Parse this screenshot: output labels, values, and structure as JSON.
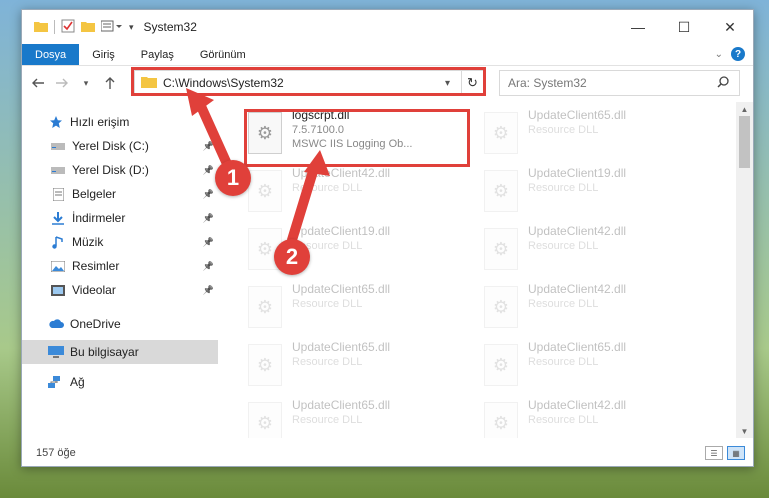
{
  "window": {
    "title": "System32",
    "controls": {
      "minimize": "—",
      "maximize": "☐",
      "close": "✕"
    }
  },
  "ribbon": {
    "tabs": [
      {
        "label": "Dosya",
        "active": true
      },
      {
        "label": "Giriş"
      },
      {
        "label": "Paylaş"
      },
      {
        "label": "Görünüm"
      }
    ],
    "expand_icon": "chevron-down-icon",
    "help_label": "?"
  },
  "navigation": {
    "address_path": "C:\\Windows\\System32",
    "search_placeholder": "Ara: System32"
  },
  "sidebar": {
    "items": [
      {
        "label": "Hızlı erişim",
        "icon": "star-icon",
        "pinned": false,
        "indent": 1
      },
      {
        "label": "Yerel Disk (C:)",
        "icon": "drive-icon",
        "pinned": true,
        "indent": 2
      },
      {
        "label": "Yerel Disk (D:)",
        "icon": "drive-icon",
        "pinned": true,
        "indent": 2
      },
      {
        "label": "Belgeler",
        "icon": "document-icon",
        "pinned": true,
        "indent": 2
      },
      {
        "label": "İndirmeler",
        "icon": "download-icon",
        "pinned": true,
        "indent": 2
      },
      {
        "label": "Müzik",
        "icon": "music-icon",
        "pinned": true,
        "indent": 2
      },
      {
        "label": "Resimler",
        "icon": "pictures-icon",
        "pinned": true,
        "indent": 2
      },
      {
        "label": "Videolar",
        "icon": "video-icon",
        "pinned": true,
        "indent": 2
      },
      {
        "label": "OneDrive",
        "icon": "cloud-icon",
        "pinned": false,
        "indent": 1
      },
      {
        "label": "Bu bilgisayar",
        "icon": "computer-icon",
        "pinned": false,
        "indent": 1,
        "selected": true
      },
      {
        "label": "Ağ",
        "icon": "network-icon",
        "pinned": false,
        "indent": 1
      }
    ]
  },
  "files": [
    {
      "name": "logscrpt.dll",
      "version": "7.5.7100.0",
      "description": "MSWC IIS Logging Ob...",
      "highlighted": true
    },
    {
      "name": "UpdateClient65.dll",
      "description": "Resource DLL"
    },
    {
      "name": "UpdateClient42.dll",
      "description": "Resource DLL"
    },
    {
      "name": "UpdateClient19.dll",
      "description": "Resource DLL"
    },
    {
      "name": "UpdateClient19.dll",
      "description": "Resource DLL"
    },
    {
      "name": "UpdateClient42.dll",
      "description": "Resource DLL"
    },
    {
      "name": "UpdateClient65.dll",
      "description": "Resource DLL"
    },
    {
      "name": "UpdateClient42.dll",
      "description": "Resource DLL"
    },
    {
      "name": "UpdateClient65.dll",
      "description": "Resource DLL"
    },
    {
      "name": "UpdateClient65.dll",
      "description": "Resource DLL"
    },
    {
      "name": "UpdateClient65.dll",
      "description": "Resource DLL"
    },
    {
      "name": "UpdateClient42.dll",
      "description": "Resource DLL"
    }
  ],
  "status": {
    "item_count": "157 öğe"
  },
  "annotations": {
    "marker_1": "1",
    "marker_2": "2",
    "color": "#e0403a"
  }
}
